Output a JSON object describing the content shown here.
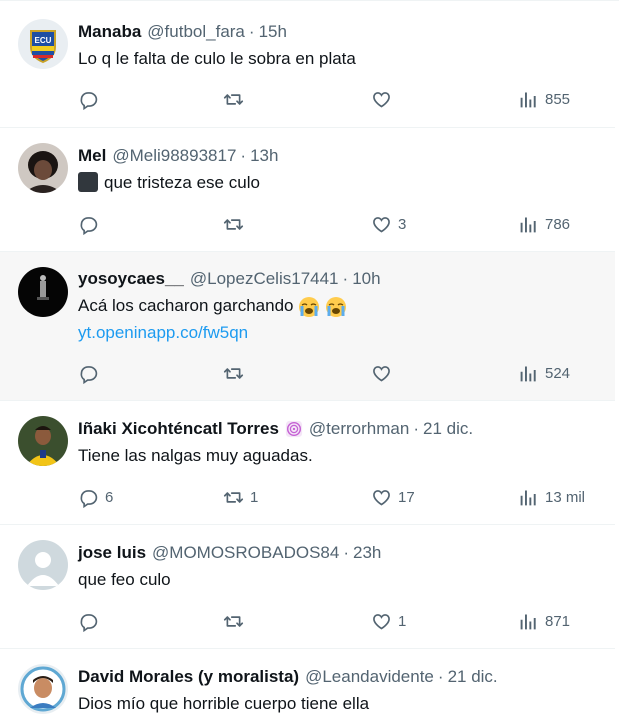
{
  "tweets": [
    {
      "name": "Manaba",
      "handle": "@futbol_fara",
      "sep": "·",
      "time": "15h",
      "text": "Lo q le falta de culo le sobra en plata",
      "replies": "",
      "retweets": "",
      "likes": "",
      "views": "855",
      "avatar_text": "ECU",
      "avatar_icon": "ecuador-crest-avatar"
    },
    {
      "name": "Mel",
      "handle": "@Meli98893817",
      "sep": "·",
      "time": "13h",
      "text": "que tristeza ese culo",
      "replies": "",
      "retweets": "",
      "likes": "3",
      "views": "786",
      "emoji": "black-square-emoji"
    },
    {
      "name": "yosoycaes__",
      "handle": "@LopezCelis17441",
      "sep": "·",
      "time": "10h",
      "text": "Acá los cacharon garchando",
      "emoji": "crying-face-emoji x2",
      "link": "yt.openinapp.co/fw5qn",
      "replies": "",
      "retweets": "",
      "likes": "",
      "views": "524"
    },
    {
      "name": "Iñaki Xicohténcatl Torres",
      "badge_icon": "spiral-emoji",
      "handle": "@terrorhman",
      "sep": "·",
      "time": "21 dic.",
      "text": "Tiene las nalgas muy aguadas.",
      "replies": "6",
      "retweets": "1",
      "likes": "17",
      "views": "13 mil"
    },
    {
      "name": "jose luis",
      "handle": "@MOMOSROBADOS84",
      "sep": "·",
      "time": "23h",
      "text": "que feo culo",
      "replies": "",
      "retweets": "",
      "likes": "1",
      "views": "871"
    },
    {
      "name": "David Morales (y moralista)",
      "handle": "@Leandavidente",
      "sep": "·",
      "time": "21 dic.",
      "text": "Dios mío que horrible cuerpo tiene ella"
    }
  ],
  "icons": {
    "reply": "reply-icon",
    "retweet": "retweet-icon",
    "like": "like-icon",
    "views": "views-icon"
  },
  "colors": {
    "text": "#0f1419",
    "secondary": "#536471",
    "link": "#1d9bf0",
    "highlight_bg": "#f7f7f7"
  }
}
